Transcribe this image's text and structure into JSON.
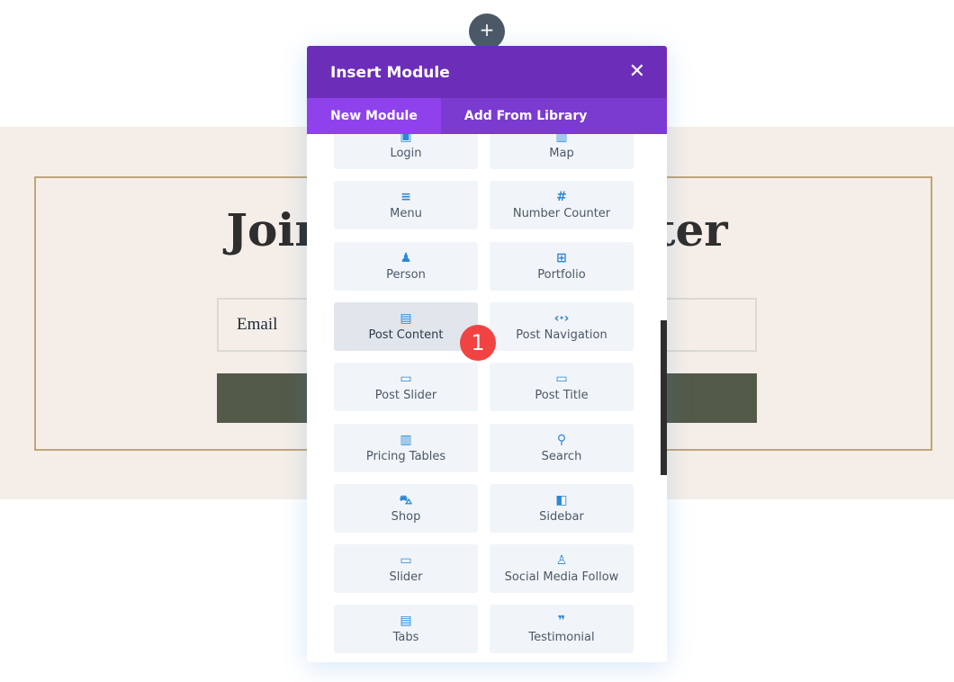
{
  "page": {
    "heading": "Join Our Newsletter",
    "email_placeholder": "Email"
  },
  "add_button": {
    "icon": "plus-icon",
    "label": "+"
  },
  "modal": {
    "title": "Insert Module",
    "close": "✕",
    "tabs": [
      {
        "label": "New Module",
        "active": true
      },
      {
        "label": "Add From Library",
        "active": false
      }
    ],
    "items": [
      {
        "label": "Login",
        "icon": "▣"
      },
      {
        "label": "Map",
        "icon": "▥"
      },
      {
        "label": "Menu",
        "icon": "≡"
      },
      {
        "label": "Number Counter",
        "icon": "#"
      },
      {
        "label": "Person",
        "icon": "♟"
      },
      {
        "label": "Portfolio",
        "icon": "⊞"
      },
      {
        "label": "Post Content",
        "icon": "▤"
      },
      {
        "label": "Post Navigation",
        "icon": "‹·›"
      },
      {
        "label": "Post Slider",
        "icon": "▭"
      },
      {
        "label": "Post Title",
        "icon": "▭"
      },
      {
        "label": "Pricing Tables",
        "icon": "▥"
      },
      {
        "label": "Search",
        "icon": "⚲"
      },
      {
        "label": "Shop",
        "icon": "⛍"
      },
      {
        "label": "Sidebar",
        "icon": "◧"
      },
      {
        "label": "Slider",
        "icon": "▭"
      },
      {
        "label": "Social Media Follow",
        "icon": "♙"
      },
      {
        "label": "Tabs",
        "icon": "▤"
      },
      {
        "label": "Testimonial",
        "icon": "❞"
      }
    ],
    "hovered_item": "Post Content"
  },
  "step_badge": "1",
  "colors": {
    "header": "#6c2eb9",
    "tabs": "#7b3ad0",
    "active_tab": "#8f42ec",
    "icon": "#2b87da",
    "badge": "#f24343"
  }
}
